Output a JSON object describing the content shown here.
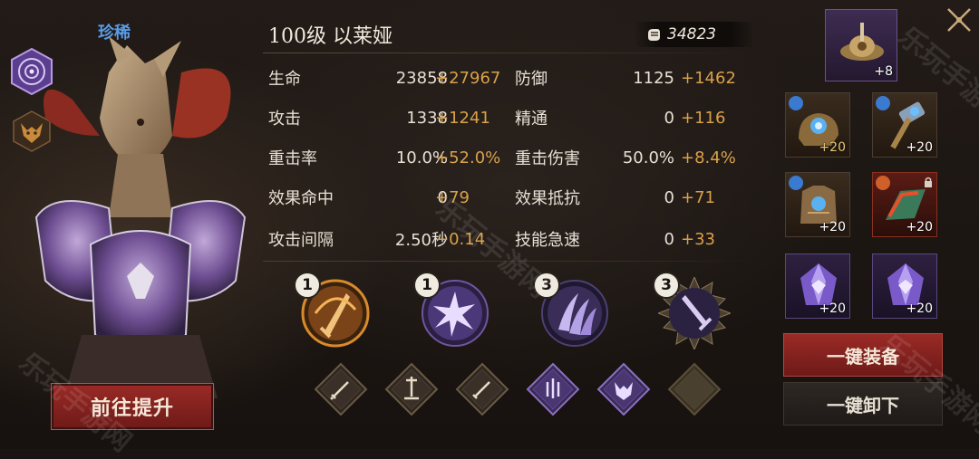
{
  "hero": {
    "rarity": "珍稀",
    "title": "100级 以莱娅",
    "power": "34823",
    "upgrade_label": "前往提升"
  },
  "stats": {
    "left": [
      {
        "label": "生命",
        "base": "23858",
        "bonus": "+27967"
      },
      {
        "label": "攻击",
        "base": "1338",
        "bonus": "+1241"
      },
      {
        "label": "重击率",
        "base": "10.0%",
        "bonus": "+52.0%"
      },
      {
        "label": "效果命中",
        "base": "0",
        "bonus": "+79"
      },
      {
        "label": "攻击间隔",
        "base": "2.50秒",
        "bonus": "−0.14"
      }
    ],
    "right": [
      {
        "label": "防御",
        "base": "1125",
        "bonus": "+1462"
      },
      {
        "label": "精通",
        "base": "0",
        "bonus": "+116"
      },
      {
        "label": "重击伤害",
        "base": "50.0%",
        "bonus": "+8.4%"
      },
      {
        "label": "效果抵抗",
        "base": "0",
        "bonus": "+71"
      },
      {
        "label": "技能急速",
        "base": "0",
        "bonus": "+33"
      }
    ]
  },
  "skills": [
    {
      "level": "1",
      "icon": "sword-slash-icon"
    },
    {
      "level": "1",
      "icon": "burst-icon"
    },
    {
      "level": "3",
      "icon": "claw-icon"
    },
    {
      "level": "3",
      "icon": "sword-down-icon"
    }
  ],
  "equipment": {
    "top_item": {
      "plus": "+8",
      "icon": "artifact-icon"
    },
    "items": [
      {
        "plus": "+20",
        "icon": "gauntlet-icon"
      },
      {
        "plus": "+20",
        "icon": "hammer-icon"
      },
      {
        "plus": "+20",
        "icon": "armor-icon"
      },
      {
        "plus": "+20",
        "icon": "bracer-icon"
      },
      {
        "plus": "+20",
        "icon": "crystal-icon"
      },
      {
        "plus": "+20",
        "icon": "crystal-icon"
      }
    ],
    "equip_all_label": "一键装备",
    "unequip_all_label": "一键卸下"
  },
  "watermark": "乐玩手游网",
  "colors": {
    "bonus": "#d9a14a",
    "rarity": "#5a9ce8",
    "button_red": "#8a2420"
  }
}
